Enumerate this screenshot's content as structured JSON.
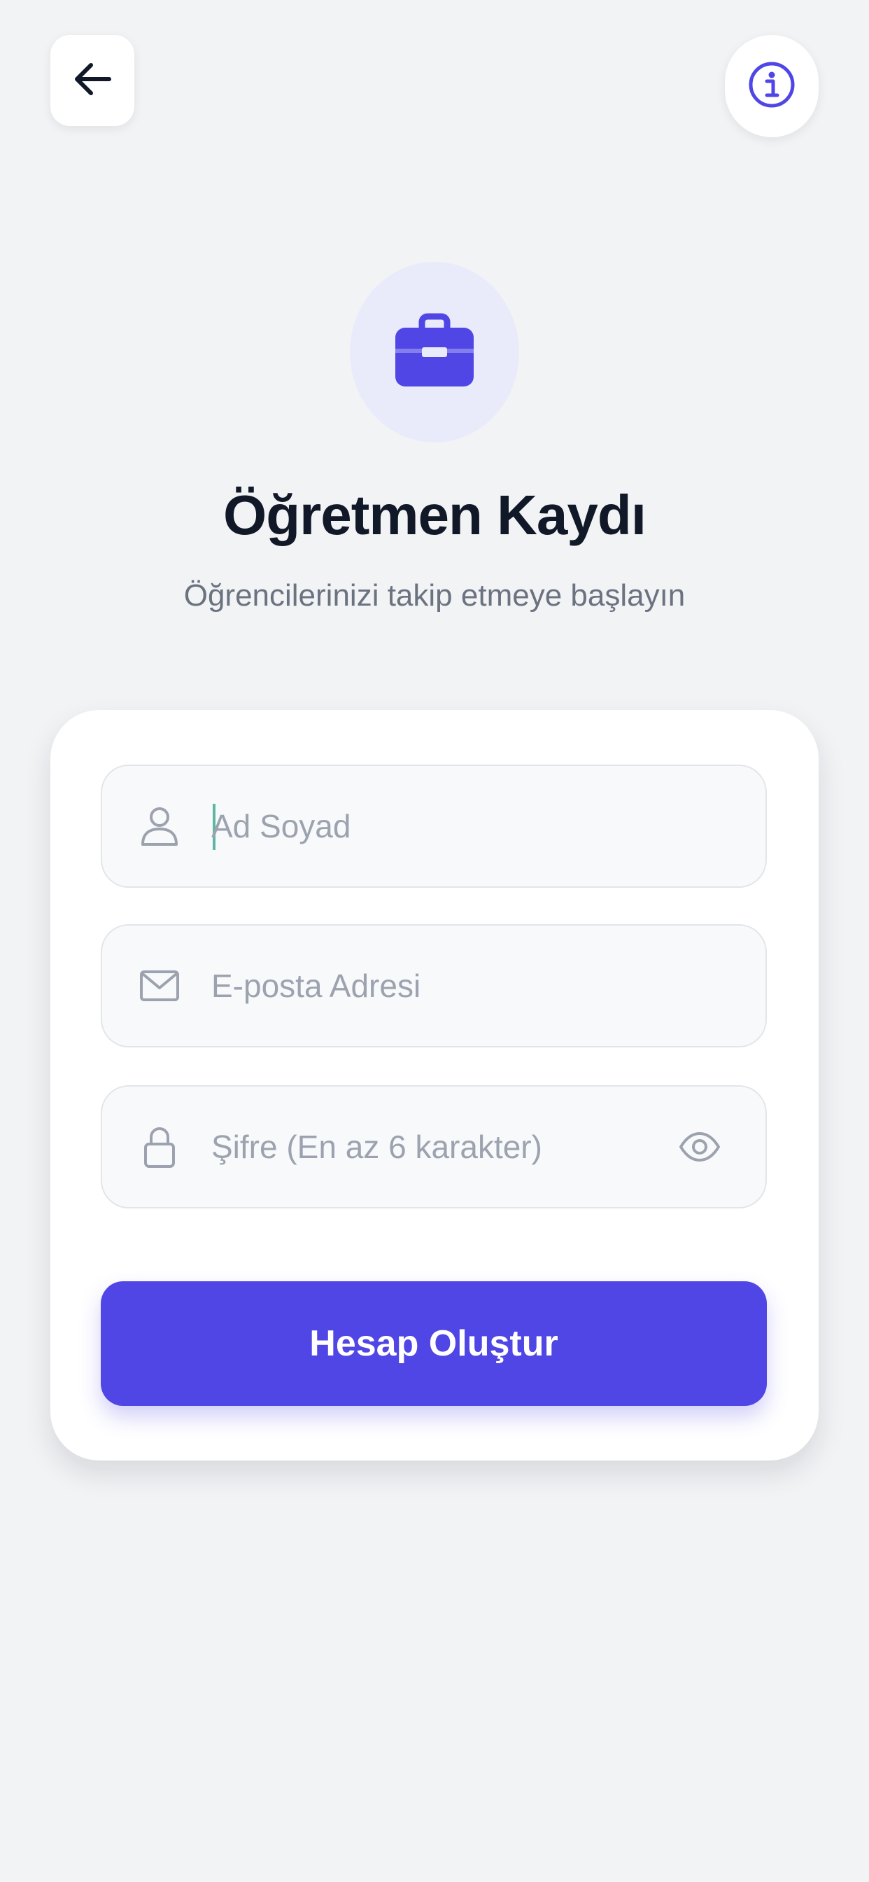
{
  "header": {
    "back_icon": "arrow-left-icon",
    "info_icon": "info-circle-icon"
  },
  "hero": {
    "icon": "briefcase-icon",
    "title": "Öğretmen Kaydı",
    "subtitle": "Öğrencilerinizi takip etmeye başlayın"
  },
  "form": {
    "name": {
      "placeholder": "Ad Soyad",
      "value": "",
      "icon": "user-icon"
    },
    "email": {
      "placeholder": "E-posta Adresi",
      "value": "",
      "icon": "mail-icon"
    },
    "password": {
      "placeholder": "Şifre (En az 6 karakter)",
      "value": "",
      "icon": "lock-icon",
      "toggle_icon": "eye-icon"
    },
    "submit_label": "Hesap Oluştur"
  },
  "colors": {
    "accent": "#4f46e5",
    "background": "#f2f3f5",
    "title": "#111827",
    "muted": "#6b7280"
  }
}
